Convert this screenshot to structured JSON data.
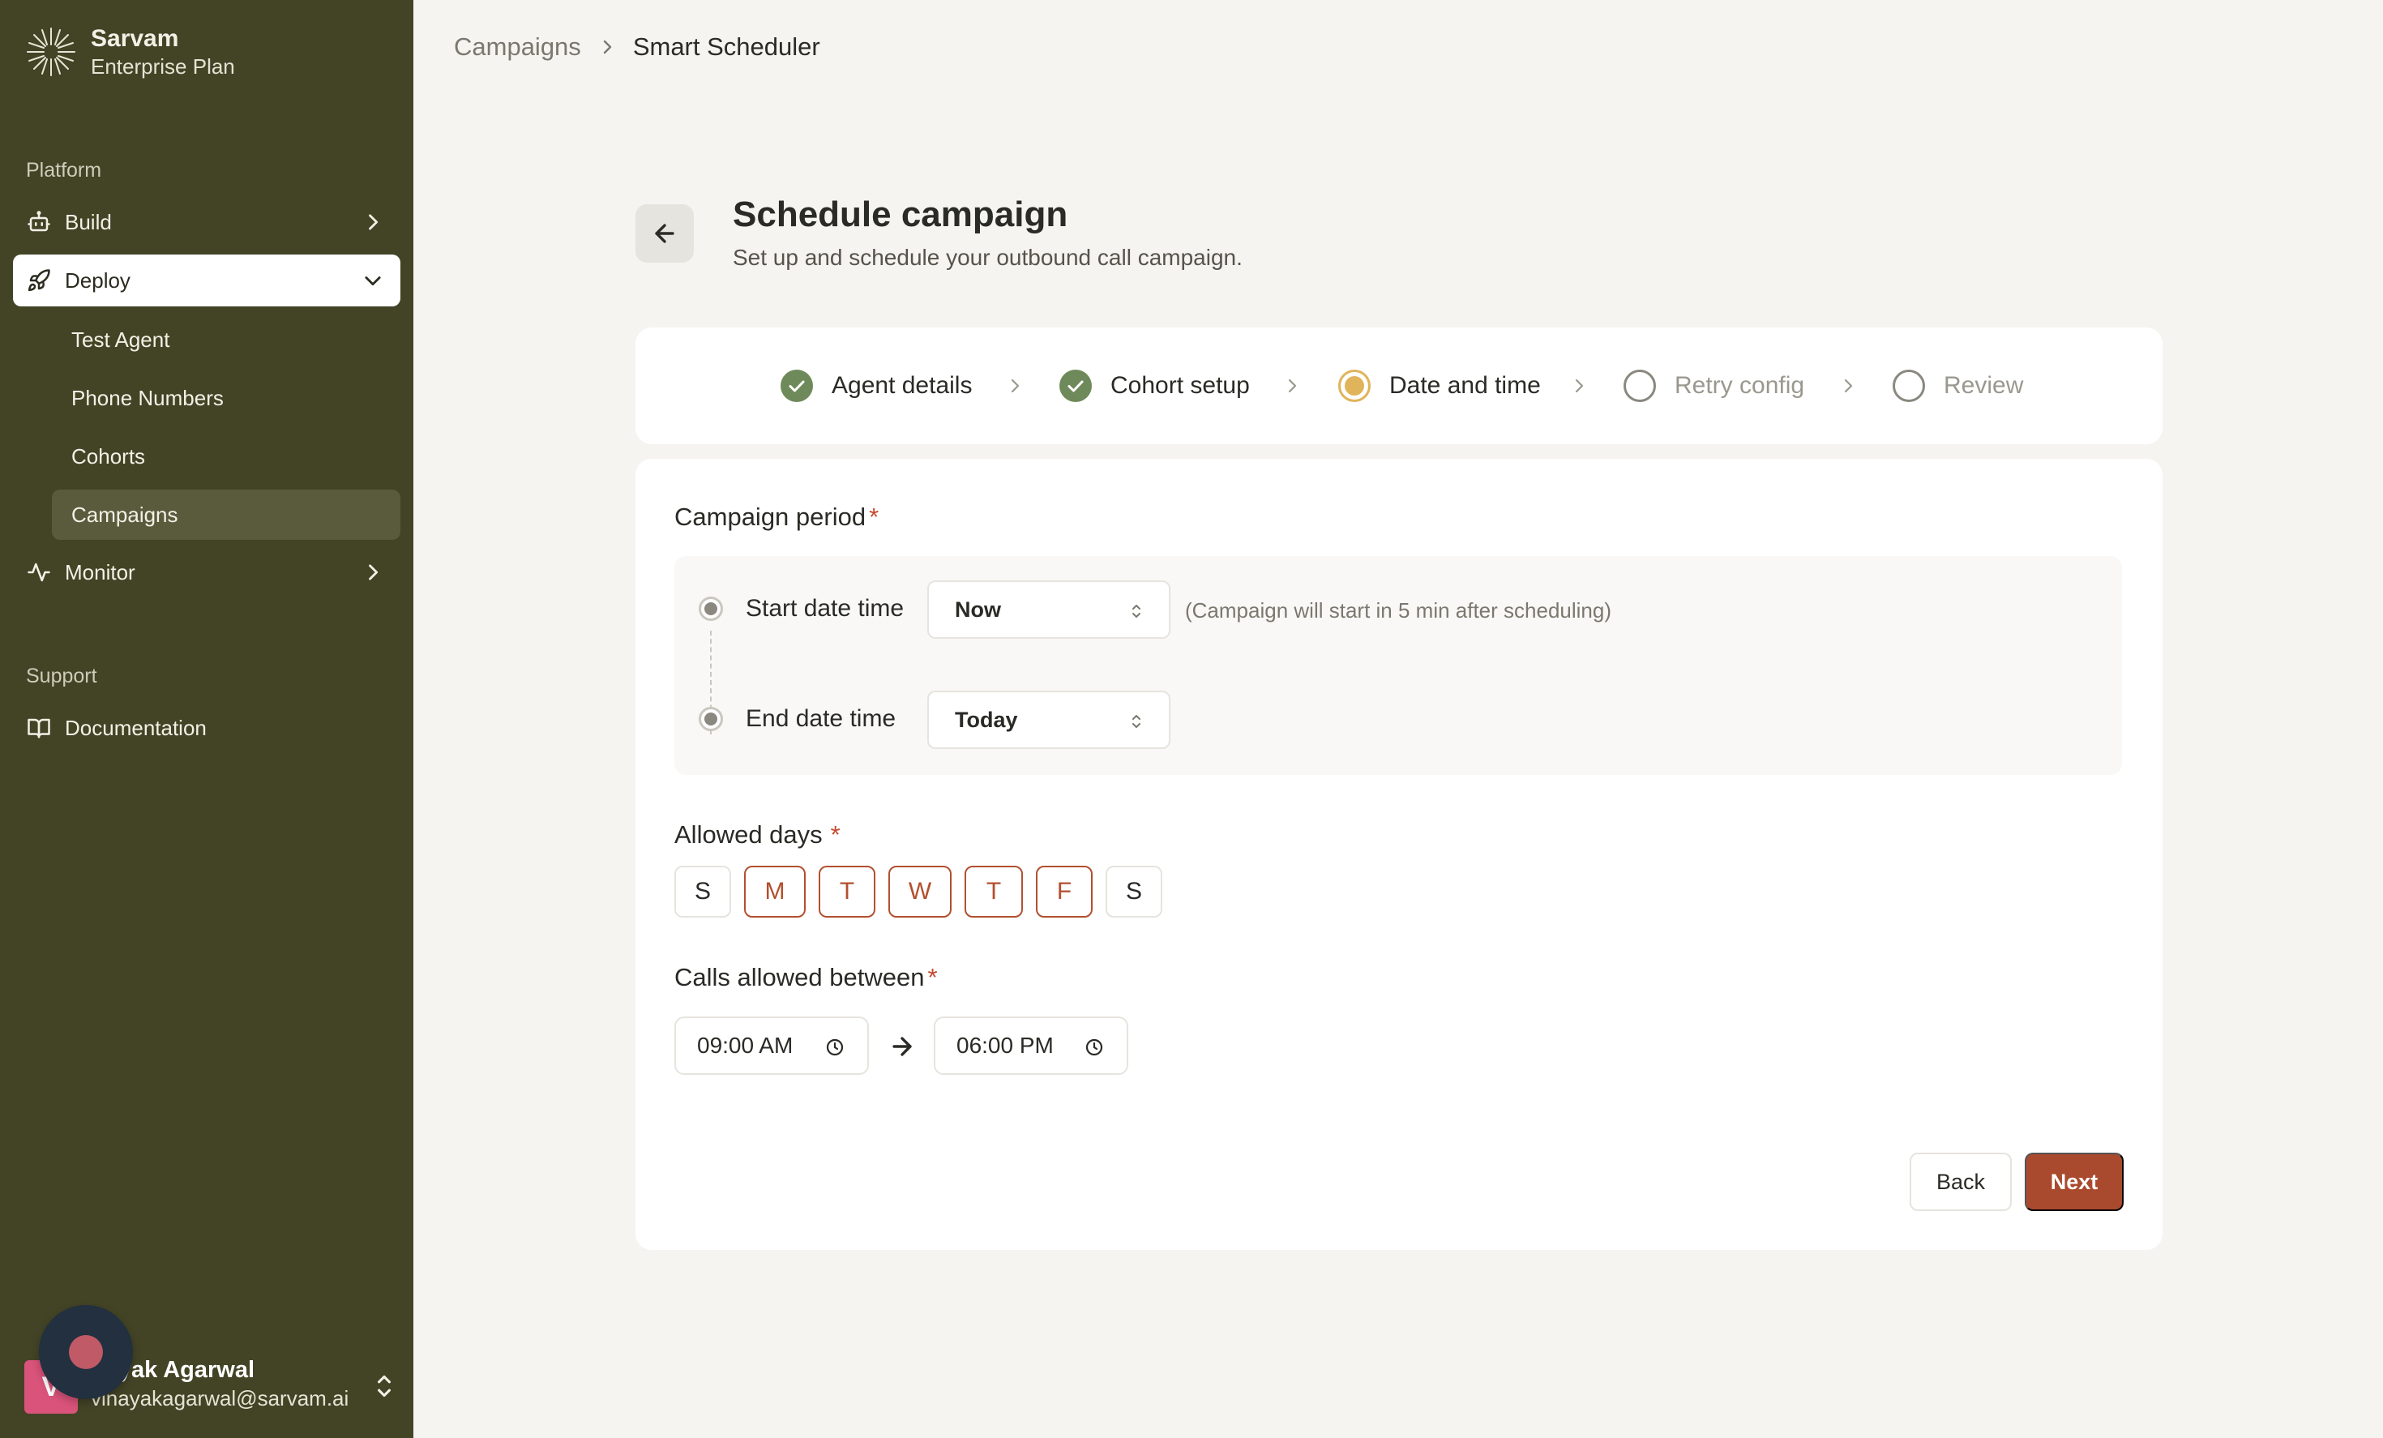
{
  "sidebar": {
    "brand": {
      "name": "Sarvam",
      "plan": "Enterprise Plan"
    },
    "platform_label": "Platform",
    "support_label": "Support",
    "items": {
      "build": "Build",
      "deploy": "Deploy",
      "monitor": "Monitor",
      "documentation": "Documentation"
    },
    "deploy_sub": [
      "Test Agent",
      "Phone Numbers",
      "Cohorts",
      "Campaigns"
    ],
    "selected_sub": "Campaigns",
    "user": {
      "initial": "V",
      "name": "Vinayak Agarwal",
      "visible_name": "nayak Agarwal",
      "email": "vinayakagarwal@sarvam.ai"
    }
  },
  "breadcrumb": [
    "Campaigns",
    "Smart Scheduler"
  ],
  "header": {
    "title": "Schedule campaign",
    "subtitle": "Set up and schedule your outbound call campaign."
  },
  "stepper": [
    {
      "label": "Agent details",
      "state": "done"
    },
    {
      "label": "Cohort setup",
      "state": "done"
    },
    {
      "label": "Date and time",
      "state": "current"
    },
    {
      "label": "Retry config",
      "state": "todo"
    },
    {
      "label": "Review",
      "state": "todo"
    }
  ],
  "form": {
    "period_label": "Campaign period",
    "required_mark": "*",
    "start_label": "Start date time",
    "start_value": "Now",
    "start_hint": "(Campaign will start in 5 min after scheduling)",
    "end_label": "End date time",
    "end_value": "Today",
    "days_label": "Allowed days",
    "days": [
      {
        "letter": "S",
        "selected": false
      },
      {
        "letter": "M",
        "selected": true
      },
      {
        "letter": "T",
        "selected": true
      },
      {
        "letter": "W",
        "selected": true
      },
      {
        "letter": "T",
        "selected": true
      },
      {
        "letter": "F",
        "selected": true
      },
      {
        "letter": "S",
        "selected": false
      }
    ],
    "calls_label": "Calls allowed between",
    "time_from": "09:00 AM",
    "time_to": "06:00 PM"
  },
  "actions": {
    "back": "Back",
    "next": "Next"
  },
  "colors": {
    "sidebar_bg": "#434326",
    "accent": "#a94a2e",
    "done_step": "#6f8a5a",
    "current_step": "#e0b45a",
    "required": "#c5492e"
  }
}
